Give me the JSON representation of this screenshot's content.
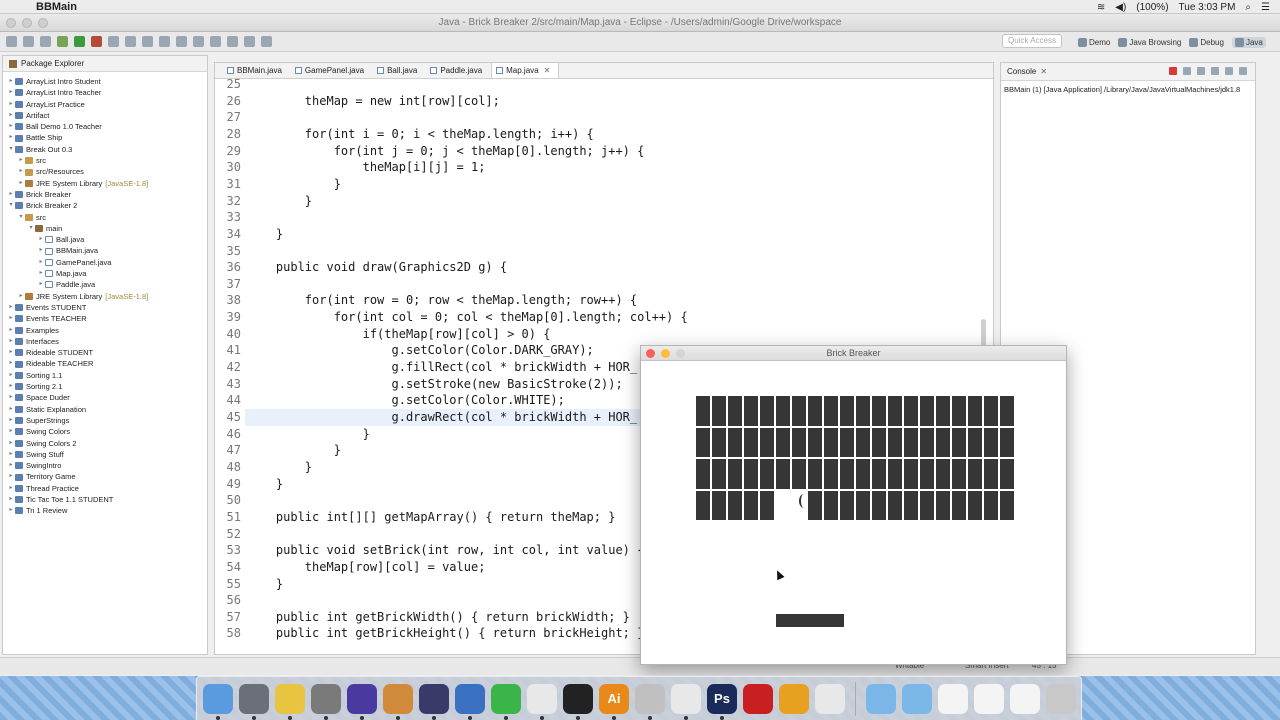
{
  "menubar": {
    "app_name": "BBMain",
    "clock": "Tue 3:03 PM",
    "battery": "(100%)"
  },
  "window": {
    "title": "Java - Brick Breaker 2/src/main/Map.java - Eclipse - /Users/admin/Google Drive/workspace"
  },
  "toolbar": {
    "quick_access_placeholder": "Quick Access",
    "perspectives": [
      "Demo",
      "Java Browsing",
      "Debug",
      "Java"
    ]
  },
  "package_explorer": {
    "title": "Package Explorer",
    "items": [
      {
        "label": "ArrayList Intro Student",
        "level": 0,
        "kind": "project",
        "twist": "▸"
      },
      {
        "label": "ArrayList Intro Teacher",
        "level": 0,
        "kind": "project",
        "twist": "▸"
      },
      {
        "label": "ArrayList Practice",
        "level": 0,
        "kind": "project",
        "twist": "▸"
      },
      {
        "label": "Artifact",
        "level": 0,
        "kind": "project",
        "twist": "▸"
      },
      {
        "label": "Ball Demo 1.0 Teacher",
        "level": 0,
        "kind": "project",
        "twist": "▸"
      },
      {
        "label": "Battle Ship",
        "level": 0,
        "kind": "project",
        "twist": "▸"
      },
      {
        "label": "Break Out 0.3",
        "level": 0,
        "kind": "project",
        "twist": "▾"
      },
      {
        "label": "src",
        "level": 1,
        "kind": "src",
        "twist": "▸"
      },
      {
        "label": "src/Resources",
        "level": 1,
        "kind": "src",
        "twist": "▸"
      },
      {
        "label": "JRE System Library",
        "suffix": "[JavaSE-1.8]",
        "level": 1,
        "kind": "lib",
        "twist": "▸"
      },
      {
        "label": "Brick Breaker",
        "level": 0,
        "kind": "project",
        "twist": "▸"
      },
      {
        "label": "Brick Breaker 2",
        "level": 0,
        "kind": "project",
        "twist": "▾"
      },
      {
        "label": "src",
        "level": 1,
        "kind": "src",
        "twist": "▾"
      },
      {
        "label": "main",
        "level": 2,
        "kind": "pkg",
        "twist": "▾"
      },
      {
        "label": "Ball.java",
        "level": 3,
        "kind": "java",
        "twist": "▸"
      },
      {
        "label": "BBMain.java",
        "level": 3,
        "kind": "java",
        "twist": "▸"
      },
      {
        "label": "GamePanel.java",
        "level": 3,
        "kind": "java",
        "twist": "▸"
      },
      {
        "label": "Map.java",
        "level": 3,
        "kind": "java",
        "twist": "▸"
      },
      {
        "label": "Paddle.java",
        "level": 3,
        "kind": "java",
        "twist": "▸"
      },
      {
        "label": "JRE System Library",
        "suffix": "[JavaSE-1.8]",
        "level": 1,
        "kind": "lib",
        "twist": "▸"
      },
      {
        "label": "Events STUDENT",
        "level": 0,
        "kind": "project",
        "twist": "▸"
      },
      {
        "label": "Events TEACHER",
        "level": 0,
        "kind": "project",
        "twist": "▸"
      },
      {
        "label": "Examples",
        "level": 0,
        "kind": "project",
        "twist": "▸"
      },
      {
        "label": "Interfaces",
        "level": 0,
        "kind": "project",
        "twist": "▸"
      },
      {
        "label": "Rideable STUDENT",
        "level": 0,
        "kind": "project",
        "twist": "▸"
      },
      {
        "label": "Rideable TEACHER",
        "level": 0,
        "kind": "project",
        "twist": "▸"
      },
      {
        "label": "Sorting 1.1",
        "level": 0,
        "kind": "project",
        "twist": "▸"
      },
      {
        "label": "Sorting 2.1",
        "level": 0,
        "kind": "project",
        "twist": "▸"
      },
      {
        "label": "Space Duder",
        "level": 0,
        "kind": "project",
        "twist": "▸"
      },
      {
        "label": "Static Explanation",
        "level": 0,
        "kind": "project",
        "twist": "▸"
      },
      {
        "label": "SuperStrings",
        "level": 0,
        "kind": "project",
        "twist": "▸"
      },
      {
        "label": "Swing Colors",
        "level": 0,
        "kind": "project",
        "twist": "▸"
      },
      {
        "label": "Swing Colors 2",
        "level": 0,
        "kind": "project",
        "twist": "▸"
      },
      {
        "label": "Swing Stuff",
        "level": 0,
        "kind": "project",
        "twist": "▸"
      },
      {
        "label": "SwingIntro",
        "level": 0,
        "kind": "project",
        "twist": "▸"
      },
      {
        "label": "Territory Game",
        "level": 0,
        "kind": "project",
        "twist": "▸"
      },
      {
        "label": "Thread Practice",
        "level": 0,
        "kind": "project",
        "twist": "▸"
      },
      {
        "label": "Tic Tac Toe 1.1 STUDENT",
        "level": 0,
        "kind": "project",
        "twist": "▸"
      },
      {
        "label": "Tri 1 Review",
        "level": 0,
        "kind": "project",
        "twist": "▸"
      }
    ]
  },
  "editor": {
    "tabs": [
      {
        "label": "BBMain.java",
        "active": false
      },
      {
        "label": "GamePanel.java",
        "active": false
      },
      {
        "label": "Ball.java",
        "active": false
      },
      {
        "label": "Paddle.java",
        "active": false
      },
      {
        "label": "Map.java",
        "active": true
      }
    ],
    "highlighted_line": 45,
    "lines": [
      {
        "n": "25",
        "t": ""
      },
      {
        "n": "26",
        "t": "        theMap = new int[row][col];"
      },
      {
        "n": "27",
        "t": ""
      },
      {
        "n": "28",
        "t": "        for(int i = 0; i < theMap.length; i++) {"
      },
      {
        "n": "29",
        "t": "            for(int j = 0; j < theMap[0].length; j++) {"
      },
      {
        "n": "30",
        "t": "                theMap[i][j] = 1;"
      },
      {
        "n": "31",
        "t": "            }"
      },
      {
        "n": "32",
        "t": "        }"
      },
      {
        "n": "33",
        "t": ""
      },
      {
        "n": "34",
        "t": "    }"
      },
      {
        "n": "35",
        "t": ""
      },
      {
        "n": "36",
        "t": "    public void draw(Graphics2D g) {"
      },
      {
        "n": "37",
        "t": ""
      },
      {
        "n": "38",
        "t": "        for(int row = 0; row < theMap.length; row++) {"
      },
      {
        "n": "39",
        "t": "            for(int col = 0; col < theMap[0].length; col++) {"
      },
      {
        "n": "40",
        "t": "                if(theMap[row][col] > 0) {"
      },
      {
        "n": "41",
        "t": "                    g.setColor(Color.DARK_GRAY);"
      },
      {
        "n": "42",
        "t": "                    g.fillRect(col * brickWidth + HOR_"
      },
      {
        "n": "43",
        "t": "                    g.setStroke(new BasicStroke(2));"
      },
      {
        "n": "44",
        "t": "                    g.setColor(Color.WHITE);"
      },
      {
        "n": "45",
        "t": "                    g.drawRect(col * brickWidth + HOR_"
      },
      {
        "n": "46",
        "t": "                }"
      },
      {
        "n": "47",
        "t": "            }"
      },
      {
        "n": "48",
        "t": "        }"
      },
      {
        "n": "49",
        "t": "    }"
      },
      {
        "n": "50",
        "t": ""
      },
      {
        "n": "51",
        "t": "    public int[][] getMapArray() { return theMap; }"
      },
      {
        "n": "52",
        "t": ""
      },
      {
        "n": "53",
        "t": "    public void setBrick(int row, int col, int value) {"
      },
      {
        "n": "54",
        "t": "        theMap[row][col] = value;"
      },
      {
        "n": "55",
        "t": "    }"
      },
      {
        "n": "56",
        "t": ""
      },
      {
        "n": "57",
        "t": "    public int getBrickWidth() { return brickWidth; }"
      },
      {
        "n": "58",
        "t": "    public int getBrickHeight() { return brickHeight; }"
      }
    ]
  },
  "console": {
    "title": "Console",
    "description": "BBMain (1) [Java Application] /Library/Java/JavaVirtualMachines/jdk1.8"
  },
  "statusbar": {
    "mode": "Writable",
    "insert": "Smart Insert",
    "position": "45 : 15"
  },
  "game": {
    "title": "Brick Breaker",
    "rows": 4,
    "cols": 20,
    "missing_bricks": [
      [
        3,
        5
      ],
      [
        3,
        6
      ]
    ]
  },
  "dock": {
    "apps": [
      "Finder",
      "Launchpad",
      "Chrome",
      "Calculator",
      "iMovie",
      "GarageBand",
      "Eclipse",
      "QuickTime",
      "Messages",
      "Apps",
      "Activity Monitor",
      "Illustrator",
      "Utilities",
      "TextEdit",
      "Photoshop",
      "Acrobat",
      "Opera",
      "Java"
    ],
    "labels": {
      "Illustrator": "Ai",
      "Photoshop": "Ps"
    }
  }
}
